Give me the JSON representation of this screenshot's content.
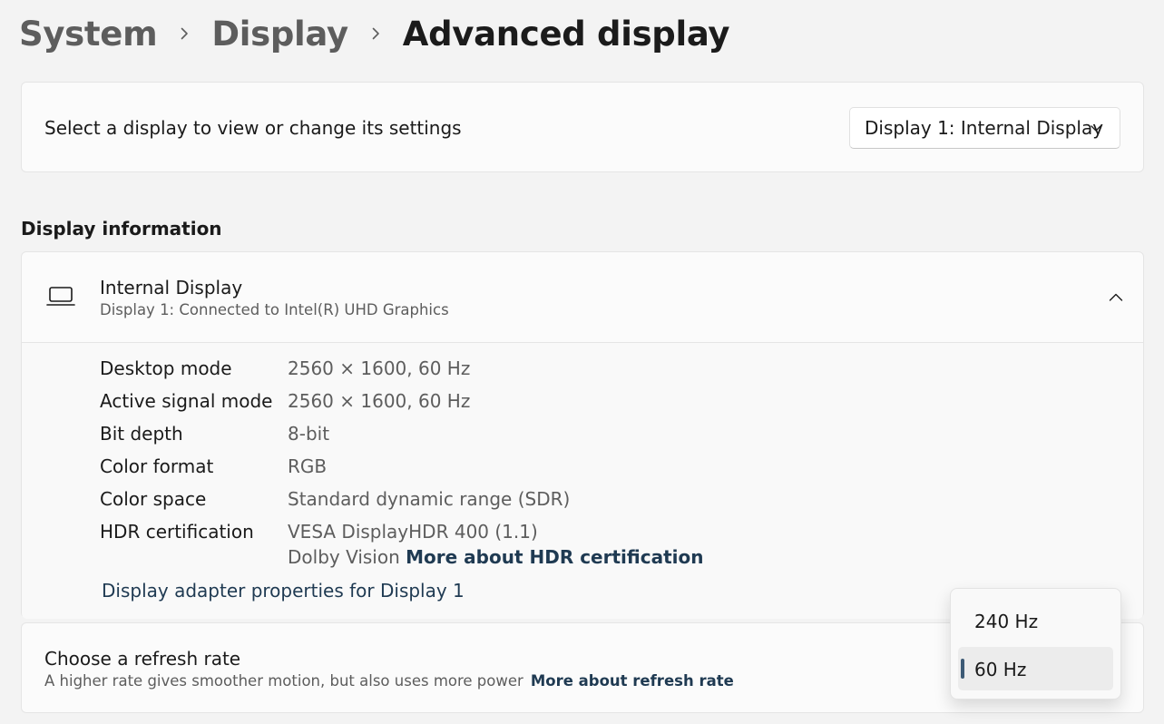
{
  "breadcrumb": {
    "items": [
      "System",
      "Display",
      "Advanced display"
    ]
  },
  "display_selector": {
    "label": "Select a display to view or change its settings",
    "selected": "Display 1: Internal Display"
  },
  "display_information": {
    "section_title": "Display information",
    "header_title": "Internal Display",
    "header_subtitle": "Display 1: Connected to Intel(R) UHD Graphics",
    "rows": [
      {
        "label": "Desktop mode",
        "value": "2560 × 1600, 60 Hz"
      },
      {
        "label": "Active signal mode",
        "value": "2560 × 1600, 60 Hz"
      },
      {
        "label": "Bit depth",
        "value": "8-bit"
      },
      {
        "label": "Color format",
        "value": "RGB"
      },
      {
        "label": "Color space",
        "value": "Standard dynamic range (SDR)"
      },
      {
        "label": "HDR certification",
        "value": "VESA DisplayHDR 400 (1.1)"
      }
    ],
    "hdr_extra": "Dolby Vision",
    "hdr_link": "More about HDR certification",
    "adapter_link": "Display adapter properties for Display 1"
  },
  "refresh_rate": {
    "title": "Choose a refresh rate",
    "description": "A higher rate gives smoother motion, but also uses more power",
    "link": "More about refresh rate",
    "options": [
      "240 Hz",
      "60 Hz"
    ],
    "selected": "60 Hz"
  },
  "icons": {
    "breadcrumb_separator": "chevron-right-icon",
    "dropdown": "chevron-down-icon",
    "display": "laptop-icon",
    "collapse": "chevron-up-icon"
  },
  "colors": {
    "link": "#1f3a52",
    "selection_indicator": "#3d5a75",
    "background": "#f3f3f3",
    "card": "#fbfbfb"
  }
}
